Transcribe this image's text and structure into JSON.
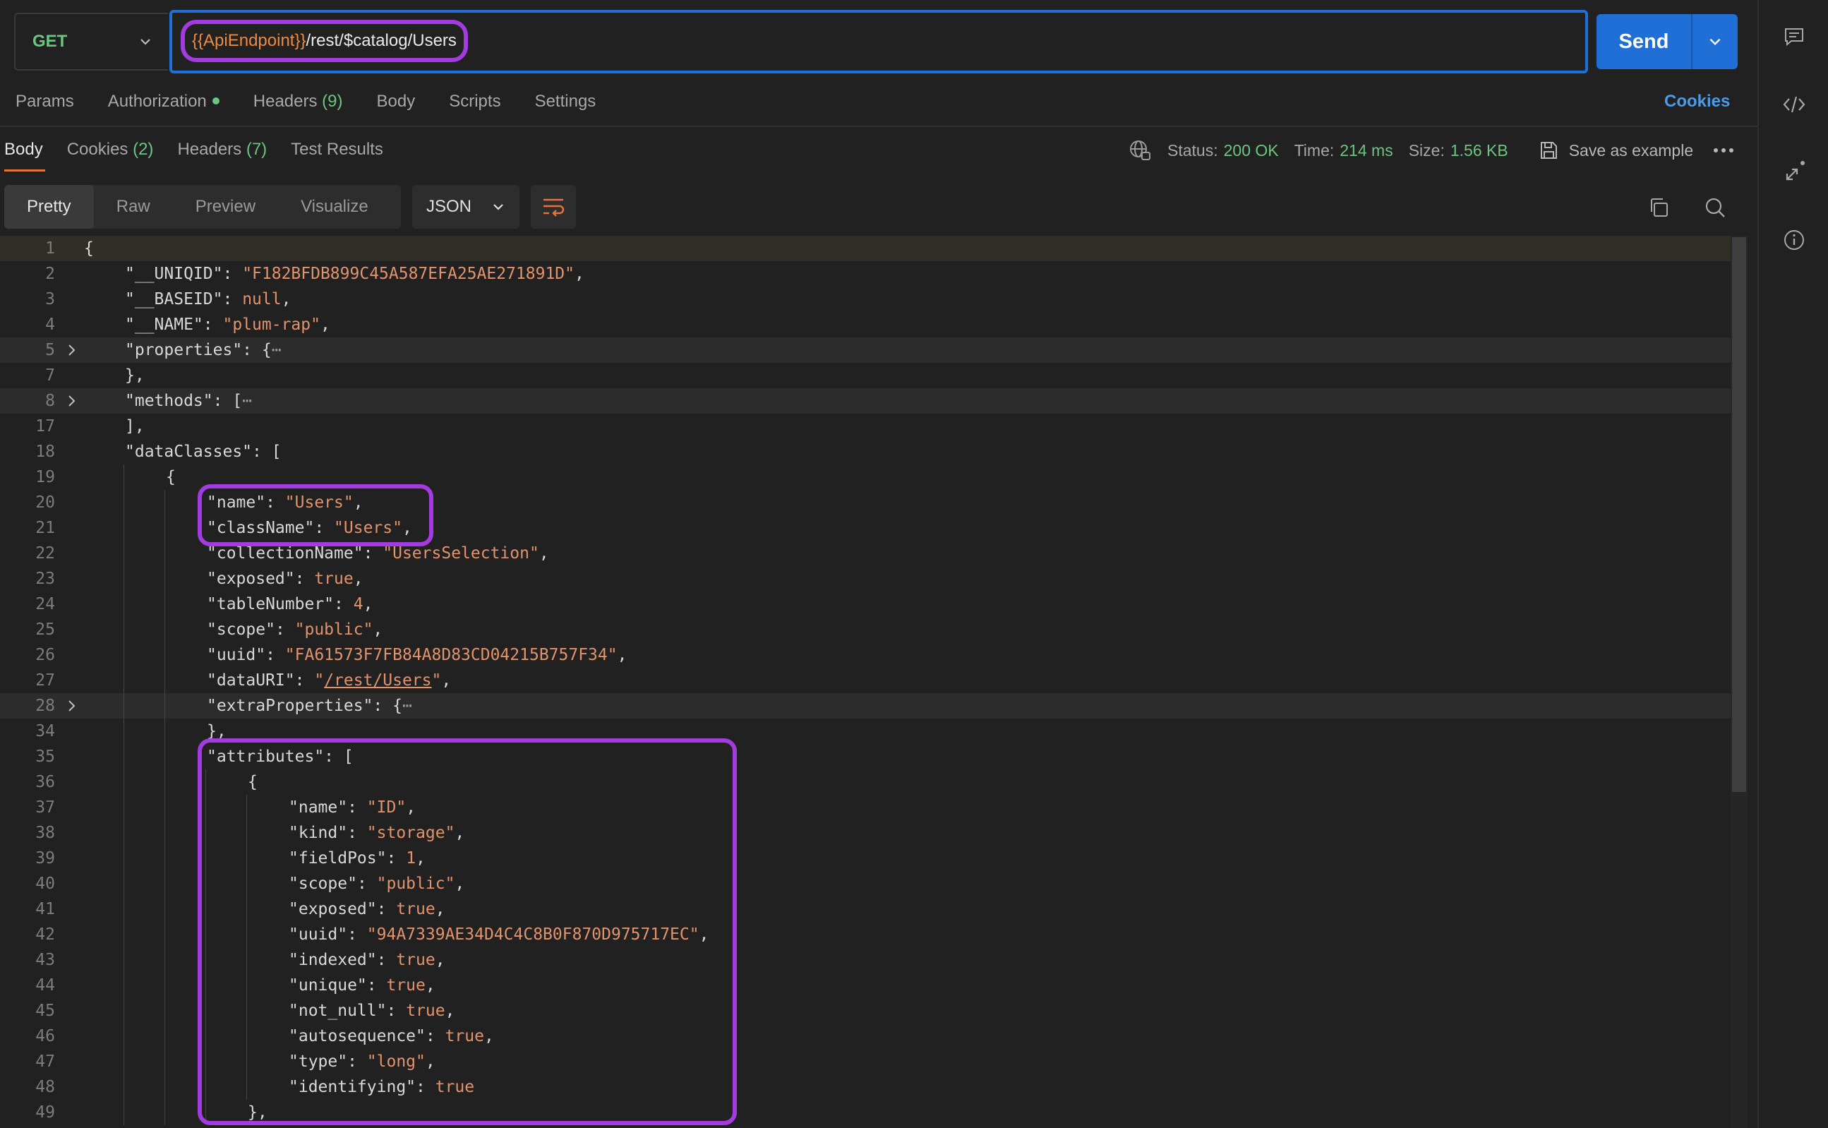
{
  "request": {
    "method": "GET",
    "url_variable": "{{ApiEndpoint}}",
    "url_path": "/rest/$catalog/Users",
    "send_label": "Send"
  },
  "request_tabs": [
    {
      "label": "Params",
      "count": ""
    },
    {
      "label": "Authorization",
      "count": ""
    },
    {
      "label": "Headers",
      "count": "(9)"
    },
    {
      "label": "Body",
      "count": ""
    },
    {
      "label": "Scripts",
      "count": ""
    },
    {
      "label": "Settings",
      "count": ""
    }
  ],
  "cookies_link": "Cookies",
  "response_tabs": [
    {
      "label": "Body",
      "count": ""
    },
    {
      "label": "Cookies",
      "count": "(2)"
    },
    {
      "label": "Headers",
      "count": "(7)"
    },
    {
      "label": "Test Results",
      "count": ""
    }
  ],
  "status": {
    "status_label": "Status:",
    "status_value": "200 OK",
    "time_label": "Time:",
    "time_value": "214 ms",
    "size_label": "Size:",
    "size_value": "1.56 KB",
    "save_label": "Save as example"
  },
  "view_modes": [
    "Pretty",
    "Raw",
    "Preview",
    "Visualize"
  ],
  "format": "JSON",
  "colors": {
    "accent": "#1f6fd6",
    "highlight_box": "#a23be0",
    "status_green": "#6bc67f",
    "string": "#e2936b"
  },
  "code_lines": [
    {
      "n": "1",
      "indent": 0,
      "parts": [
        [
          "p",
          "{"
        ]
      ]
    },
    {
      "n": "2",
      "indent": 1,
      "parts": [
        [
          "k",
          "\"__UNIQID\""
        ],
        [
          "p",
          ": "
        ],
        [
          "s",
          "\"F182BFDB899C45A587EFA25AE271891D\""
        ],
        [
          "p",
          ","
        ]
      ]
    },
    {
      "n": "3",
      "indent": 1,
      "parts": [
        [
          "k",
          "\"__BASEID\""
        ],
        [
          "p",
          ": "
        ],
        [
          "lit",
          "null"
        ],
        [
          "p",
          ","
        ]
      ]
    },
    {
      "n": "4",
      "indent": 1,
      "parts": [
        [
          "k",
          "\"__NAME\""
        ],
        [
          "p",
          ": "
        ],
        [
          "s",
          "\"plum-rap\""
        ],
        [
          "p",
          ","
        ]
      ]
    },
    {
      "n": "5",
      "indent": 1,
      "fold": true,
      "hl": true,
      "parts": [
        [
          "k",
          "\"properties\""
        ],
        [
          "p",
          ": {"
        ],
        [
          "ell",
          "⋯"
        ]
      ]
    },
    {
      "n": "7",
      "indent": 1,
      "parts": [
        [
          "p",
          "},"
        ]
      ]
    },
    {
      "n": "8",
      "indent": 1,
      "fold": true,
      "hl": true,
      "parts": [
        [
          "k",
          "\"methods\""
        ],
        [
          "p",
          ": ["
        ],
        [
          "ell",
          "⋯"
        ]
      ]
    },
    {
      "n": "17",
      "indent": 1,
      "parts": [
        [
          "p",
          "],"
        ]
      ]
    },
    {
      "n": "18",
      "indent": 1,
      "parts": [
        [
          "k",
          "\"dataClasses\""
        ],
        [
          "p",
          ": ["
        ]
      ]
    },
    {
      "n": "19",
      "indent": 2,
      "parts": [
        [
          "p",
          "{"
        ]
      ]
    },
    {
      "n": "20",
      "indent": 3,
      "parts": [
        [
          "k",
          "\"name\""
        ],
        [
          "p",
          ": "
        ],
        [
          "s",
          "\"Users\""
        ],
        [
          "p",
          ","
        ]
      ]
    },
    {
      "n": "21",
      "indent": 3,
      "parts": [
        [
          "k",
          "\"className\""
        ],
        [
          "p",
          ": "
        ],
        [
          "s",
          "\"Users\""
        ],
        [
          "p",
          ","
        ]
      ]
    },
    {
      "n": "22",
      "indent": 3,
      "parts": [
        [
          "k",
          "\"collectionName\""
        ],
        [
          "p",
          ": "
        ],
        [
          "s",
          "\"UsersSelection\""
        ],
        [
          "p",
          ","
        ]
      ]
    },
    {
      "n": "23",
      "indent": 3,
      "parts": [
        [
          "k",
          "\"exposed\""
        ],
        [
          "p",
          ": "
        ],
        [
          "lit",
          "true"
        ],
        [
          "p",
          ","
        ]
      ]
    },
    {
      "n": "24",
      "indent": 3,
      "parts": [
        [
          "k",
          "\"tableNumber\""
        ],
        [
          "p",
          ": "
        ],
        [
          "lit",
          "4"
        ],
        [
          "p",
          ","
        ]
      ]
    },
    {
      "n": "25",
      "indent": 3,
      "parts": [
        [
          "k",
          "\"scope\""
        ],
        [
          "p",
          ": "
        ],
        [
          "s",
          "\"public\""
        ],
        [
          "p",
          ","
        ]
      ]
    },
    {
      "n": "26",
      "indent": 3,
      "parts": [
        [
          "k",
          "\"uuid\""
        ],
        [
          "p",
          ": "
        ],
        [
          "s",
          "\"FA61573F7FB84A8D83CD04215B757F34\""
        ],
        [
          "p",
          ","
        ]
      ]
    },
    {
      "n": "27",
      "indent": 3,
      "parts": [
        [
          "k",
          "\"dataURI\""
        ],
        [
          "p",
          ": "
        ],
        [
          "s",
          "\""
        ],
        [
          "link",
          "/rest/Users"
        ],
        [
          "s",
          "\""
        ],
        [
          "p",
          ","
        ]
      ]
    },
    {
      "n": "28",
      "indent": 3,
      "fold": true,
      "hl": true,
      "parts": [
        [
          "k",
          "\"extraProperties\""
        ],
        [
          "p",
          ": {"
        ],
        [
          "ell",
          "⋯"
        ]
      ]
    },
    {
      "n": "34",
      "indent": 3,
      "parts": [
        [
          "p",
          "},"
        ]
      ]
    },
    {
      "n": "35",
      "indent": 3,
      "parts": [
        [
          "k",
          "\"attributes\""
        ],
        [
          "p",
          ": ["
        ]
      ]
    },
    {
      "n": "36",
      "indent": 4,
      "parts": [
        [
          "p",
          "{"
        ]
      ]
    },
    {
      "n": "37",
      "indent": 5,
      "parts": [
        [
          "k",
          "\"name\""
        ],
        [
          "p",
          ": "
        ],
        [
          "s",
          "\"ID\""
        ],
        [
          "p",
          ","
        ]
      ]
    },
    {
      "n": "38",
      "indent": 5,
      "parts": [
        [
          "k",
          "\"kind\""
        ],
        [
          "p",
          ": "
        ],
        [
          "s",
          "\"storage\""
        ],
        [
          "p",
          ","
        ]
      ]
    },
    {
      "n": "39",
      "indent": 5,
      "parts": [
        [
          "k",
          "\"fieldPos\""
        ],
        [
          "p",
          ": "
        ],
        [
          "lit",
          "1"
        ],
        [
          "p",
          ","
        ]
      ]
    },
    {
      "n": "40",
      "indent": 5,
      "parts": [
        [
          "k",
          "\"scope\""
        ],
        [
          "p",
          ": "
        ],
        [
          "s",
          "\"public\""
        ],
        [
          "p",
          ","
        ]
      ]
    },
    {
      "n": "41",
      "indent": 5,
      "parts": [
        [
          "k",
          "\"exposed\""
        ],
        [
          "p",
          ": "
        ],
        [
          "lit",
          "true"
        ],
        [
          "p",
          ","
        ]
      ]
    },
    {
      "n": "42",
      "indent": 5,
      "parts": [
        [
          "k",
          "\"uuid\""
        ],
        [
          "p",
          ": "
        ],
        [
          "s",
          "\"94A7339AE34D4C4C8B0F870D975717EC\""
        ],
        [
          "p",
          ","
        ]
      ]
    },
    {
      "n": "43",
      "indent": 5,
      "parts": [
        [
          "k",
          "\"indexed\""
        ],
        [
          "p",
          ": "
        ],
        [
          "lit",
          "true"
        ],
        [
          "p",
          ","
        ]
      ]
    },
    {
      "n": "44",
      "indent": 5,
      "parts": [
        [
          "k",
          "\"unique\""
        ],
        [
          "p",
          ": "
        ],
        [
          "lit",
          "true"
        ],
        [
          "p",
          ","
        ]
      ]
    },
    {
      "n": "45",
      "indent": 5,
      "parts": [
        [
          "k",
          "\"not_null\""
        ],
        [
          "p",
          ": "
        ],
        [
          "lit",
          "true"
        ],
        [
          "p",
          ","
        ]
      ]
    },
    {
      "n": "46",
      "indent": 5,
      "parts": [
        [
          "k",
          "\"autosequence\""
        ],
        [
          "p",
          ": "
        ],
        [
          "lit",
          "true"
        ],
        [
          "p",
          ","
        ]
      ]
    },
    {
      "n": "47",
      "indent": 5,
      "parts": [
        [
          "k",
          "\"type\""
        ],
        [
          "p",
          ": "
        ],
        [
          "s",
          "\"long\""
        ],
        [
          "p",
          ","
        ]
      ]
    },
    {
      "n": "48",
      "indent": 5,
      "parts": [
        [
          "k",
          "\"identifying\""
        ],
        [
          "p",
          ": "
        ],
        [
          "lit",
          "true"
        ]
      ]
    },
    {
      "n": "49",
      "indent": 4,
      "parts": [
        [
          "p",
          "},"
        ]
      ]
    }
  ]
}
